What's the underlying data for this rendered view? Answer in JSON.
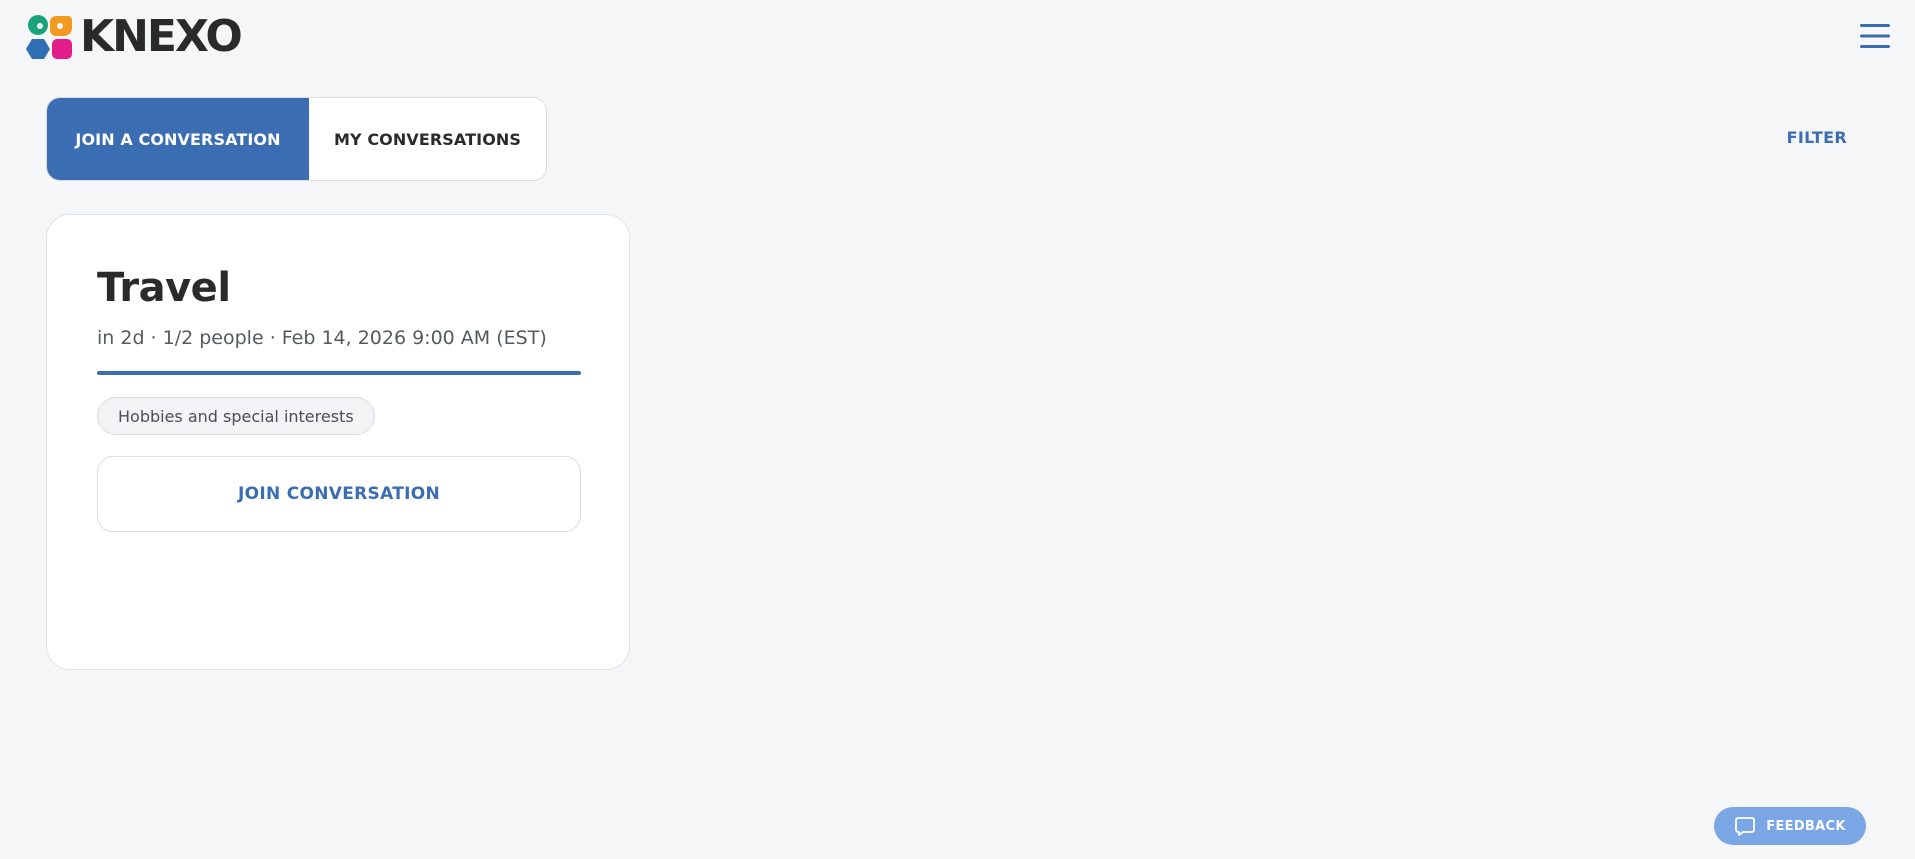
{
  "header": {
    "brand": "KNEXO",
    "logo_icon": "knexo-logo-icon",
    "menu_icon": "hamburger-menu-icon",
    "accent_color": "#3a6db1"
  },
  "tabs": [
    {
      "label": "JOIN A CONVERSATION",
      "active": true
    },
    {
      "label": "MY CONVERSATIONS",
      "active": false
    }
  ],
  "filter_label": "FILTER",
  "conversations": [
    {
      "title": "Travel",
      "meta": "in 2d · 1/2 people · Feb 14, 2026 9:00 AM (EST)",
      "progress": 1.0,
      "tag": "Hobbies and special interests",
      "join_label": "JOIN CONVERSATION"
    }
  ],
  "feedback": {
    "label": "FEEDBACK",
    "icon": "chat-bubble-icon"
  }
}
